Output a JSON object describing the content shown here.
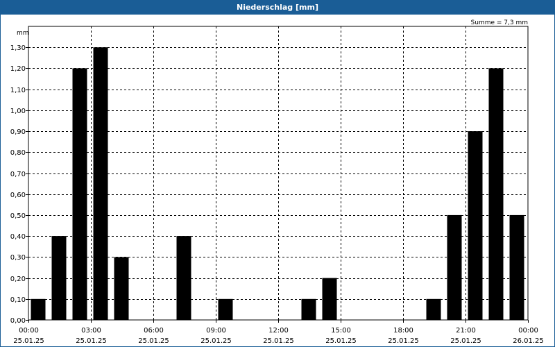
{
  "window": {
    "title": "Niederschlag [mm]"
  },
  "colors": {
    "titlebar": "#1a5d96",
    "bar": "#000000",
    "grid": "#000000"
  },
  "chart_data": {
    "type": "bar",
    "title": "Niederschlag [mm]",
    "ylabel": "mm",
    "summary": "Summe = 7,3 mm",
    "ylim": [
      0,
      1.4
    ],
    "grid": true,
    "ytick_values": [
      0,
      0.1,
      0.2,
      0.3,
      0.4,
      0.5,
      0.6,
      0.7,
      0.8,
      0.9,
      1.0,
      1.1,
      1.2,
      1.3
    ],
    "ytick_labels": [
      "0,00",
      "0,10",
      "0,20",
      "0,30",
      "0,40",
      "0,50",
      "0,60",
      "0,70",
      "0,80",
      "0,90",
      "1,00",
      "1,10",
      "1,20",
      "1,30"
    ],
    "x_ticks": [
      {
        "hour": 0,
        "time": "00:00",
        "date": "25.01.25"
      },
      {
        "hour": 3,
        "time": "03:00",
        "date": "25.01.25"
      },
      {
        "hour": 6,
        "time": "06:00",
        "date": "25.01.25"
      },
      {
        "hour": 9,
        "time": "09:00",
        "date": "25.01.25"
      },
      {
        "hour": 12,
        "time": "12:00",
        "date": "25.01.25"
      },
      {
        "hour": 15,
        "time": "15:00",
        "date": "25.01.25"
      },
      {
        "hour": 18,
        "time": "18:00",
        "date": "25.01.25"
      },
      {
        "hour": 21,
        "time": "21:00",
        "date": "25.01.25"
      },
      {
        "hour": 24,
        "time": "00:00",
        "date": "26.01.25"
      }
    ],
    "xlim_hours": [
      0,
      24
    ],
    "bars": [
      {
        "hour": 0,
        "value": 0.1
      },
      {
        "hour": 1,
        "value": 0.4
      },
      {
        "hour": 2,
        "value": 1.2
      },
      {
        "hour": 3,
        "value": 1.3
      },
      {
        "hour": 4,
        "value": 0.3
      },
      {
        "hour": 5,
        "value": 0.0
      },
      {
        "hour": 6,
        "value": 0.0
      },
      {
        "hour": 7,
        "value": 0.4
      },
      {
        "hour": 8,
        "value": 0.0
      },
      {
        "hour": 9,
        "value": 0.1
      },
      {
        "hour": 10,
        "value": 0.0
      },
      {
        "hour": 11,
        "value": 0.0
      },
      {
        "hour": 12,
        "value": 0.0
      },
      {
        "hour": 13,
        "value": 0.1
      },
      {
        "hour": 14,
        "value": 0.2
      },
      {
        "hour": 15,
        "value": 0.0
      },
      {
        "hour": 16,
        "value": 0.0
      },
      {
        "hour": 17,
        "value": 0.0
      },
      {
        "hour": 18,
        "value": 0.0
      },
      {
        "hour": 19,
        "value": 0.1
      },
      {
        "hour": 20,
        "value": 0.5
      },
      {
        "hour": 21,
        "value": 0.9
      },
      {
        "hour": 22,
        "value": 1.2
      },
      {
        "hour": 23,
        "value": 0.5
      }
    ]
  }
}
